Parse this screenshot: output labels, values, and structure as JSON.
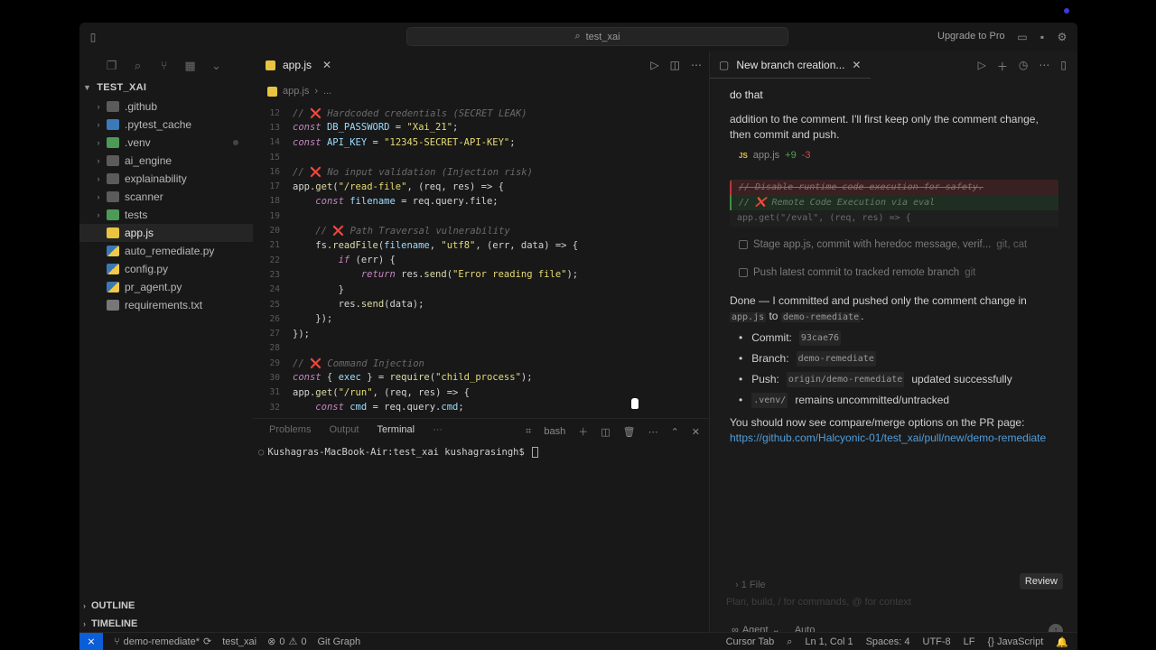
{
  "titlebar": {
    "search_text": "test_xai",
    "upgrade_label": "Upgrade to Pro"
  },
  "explorer": {
    "project_name": "TEST_XAI",
    "items": [
      {
        "label": ".github",
        "type": "folder-special",
        "expandable": true
      },
      {
        "label": ".pytest_cache",
        "type": "folder-blue",
        "expandable": true
      },
      {
        "label": ".venv",
        "type": "folder-green",
        "expandable": true
      },
      {
        "label": "ai_engine",
        "type": "folder",
        "expandable": true
      },
      {
        "label": "explainability",
        "type": "folder",
        "expandable": true
      },
      {
        "label": "scanner",
        "type": "folder",
        "expandable": true
      },
      {
        "label": "tests",
        "type": "folder-green",
        "expandable": true
      },
      {
        "label": "app.js",
        "type": "js",
        "expandable": false,
        "selected": true
      },
      {
        "label": "auto_remediate.py",
        "type": "py",
        "expandable": false
      },
      {
        "label": "config.py",
        "type": "py",
        "expandable": false
      },
      {
        "label": "pr_agent.py",
        "type": "py",
        "expandable": false
      },
      {
        "label": "requirements.txt",
        "type": "txt",
        "expandable": false
      }
    ],
    "outline_label": "OUTLINE",
    "timeline_label": "TIMELINE"
  },
  "editor": {
    "tab_label": "app.js",
    "breadcrumb_file": "app.js",
    "breadcrumb_more": "...",
    "lines": [
      {
        "n": "12",
        "text": "// ❌ Hardcoded credentials (SECRET LEAK)"
      },
      {
        "n": "13",
        "text": "const DB_PASSWORD = \"Xai_21\";"
      },
      {
        "n": "14",
        "text": "const API_KEY = \"12345-SECRET-API-KEY\";"
      },
      {
        "n": "15",
        "text": ""
      },
      {
        "n": "16",
        "text": "// ❌ No input validation (Injection risk)"
      },
      {
        "n": "17",
        "text": "app.get(\"/read-file\", (req, res) => {"
      },
      {
        "n": "18",
        "text": "    const filename = req.query.file;"
      },
      {
        "n": "19",
        "text": ""
      },
      {
        "n": "20",
        "text": "    // ❌ Path Traversal vulnerability"
      },
      {
        "n": "21",
        "text": "    fs.readFile(filename, \"utf8\", (err, data) => {"
      },
      {
        "n": "22",
        "text": "        if (err) {"
      },
      {
        "n": "23",
        "text": "            return res.send(\"Error reading file\");"
      },
      {
        "n": "24",
        "text": "        }"
      },
      {
        "n": "25",
        "text": "        res.send(data);"
      },
      {
        "n": "26",
        "text": "    });"
      },
      {
        "n": "27",
        "text": "});"
      },
      {
        "n": "28",
        "text": ""
      },
      {
        "n": "29",
        "text": "// ❌ Command Injection"
      },
      {
        "n": "30",
        "text": "const { exec } = require(\"child_process\");"
      },
      {
        "n": "31",
        "text": "app.get(\"/run\", (req, res) => {"
      },
      {
        "n": "32",
        "text": "    const cmd = req.query.cmd;"
      }
    ]
  },
  "panel": {
    "tabs": [
      "Problems",
      "Output",
      "Terminal",
      "···"
    ],
    "active_tab": "Terminal",
    "shell_label": "bash",
    "prompt": "Kushagras-MacBook-Air:test_xai kushagrasingh$"
  },
  "chat": {
    "tab_label": "New branch creation...",
    "user_message": "do that",
    "intro_text": "addition to the comment. I'll first keep only the comment change, then commit and push.",
    "diff_file": "app.js",
    "diff_plus": "+9",
    "diff_minus": "-3",
    "diff_lines": {
      "deleted": "// Disable runtime code execution for safety.",
      "added": "// ❌ Remote Code Execution via eval",
      "context": "app.get(\"/eval\", (req, res) => {"
    },
    "tool_calls": [
      {
        "label": "Stage app.js, commit with heredoc message, verif...",
        "meta": "git, cat"
      },
      {
        "label": "Push latest commit to tracked remote branch",
        "meta": "git"
      }
    ],
    "done_prefix": "Done — I committed and pushed only the comment change in",
    "done_file": "app.js",
    "done_to": "to",
    "done_branch": "demo-remediate",
    "done_suffix": ".",
    "bullets": [
      {
        "label": "Commit:",
        "code": "93cae76",
        "suffix": ""
      },
      {
        "label": "Branch:",
        "code": "demo-remediate",
        "suffix": ""
      },
      {
        "label": "Push:",
        "code": "origin/demo-remediate",
        "suffix": "updated successfully"
      },
      {
        "label": "",
        "code": ".venv/",
        "suffix": "remains uncommitted/untracked"
      }
    ],
    "compare_text": "You should now see compare/merge options on the PR page:",
    "pr_link": "https://github.com/Halcyonic-01/test_xai/pull/new/demo-remediate",
    "files_label": "1 File",
    "review_label": "Review",
    "input_placeholder": "Plan, build, / for commands, @ for context",
    "agent_label": "Agent",
    "model_label": "Auto"
  },
  "statusbar": {
    "branch": "demo-remediate*",
    "project": "test_xai",
    "errors": "0",
    "warnings": "0",
    "git_graph": "Git Graph",
    "cursor_tab": "Cursor Tab",
    "position": "Ln 1, Col 1",
    "spaces": "Spaces: 4",
    "encoding": "UTF-8",
    "eol": "LF",
    "language": "JavaScript"
  }
}
